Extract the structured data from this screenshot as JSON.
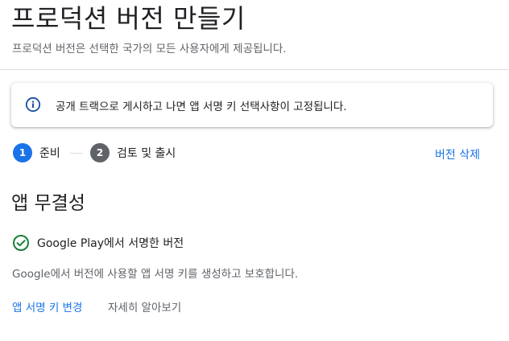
{
  "page": {
    "title": "프로덕션 버전 만들기",
    "subtitle": "프로덕션 버전은 선택한 국가의 모든 사용자에게 제공됩니다."
  },
  "info_banner": {
    "icon": "info-icon",
    "text": "공개 트랙으로 게시하고 나면 앱 서명 키 선택사항이 고정됩니다."
  },
  "stepper": {
    "steps": [
      {
        "number": "1",
        "label": "준비",
        "state": "active",
        "color": "#1a73e8"
      },
      {
        "number": "2",
        "label": "검토 및 출시",
        "state": "inactive",
        "color": "#5f6368"
      }
    ],
    "delete_label": "버전 삭제"
  },
  "app_integrity": {
    "title": "앱 무결성",
    "status_icon": "check-circle-icon",
    "status_text": "Google Play에서 서명한 버전",
    "description": "Google에서 버전에 사용할 앱 서명 키를 생성하고 보호합니다.",
    "change_key_label": "앱 서명 키 변경",
    "learn_more_label": "자세히 알아보기"
  },
  "colors": {
    "accent": "#1a73e8",
    "success": "#188038",
    "info_icon": "#174ea6"
  }
}
